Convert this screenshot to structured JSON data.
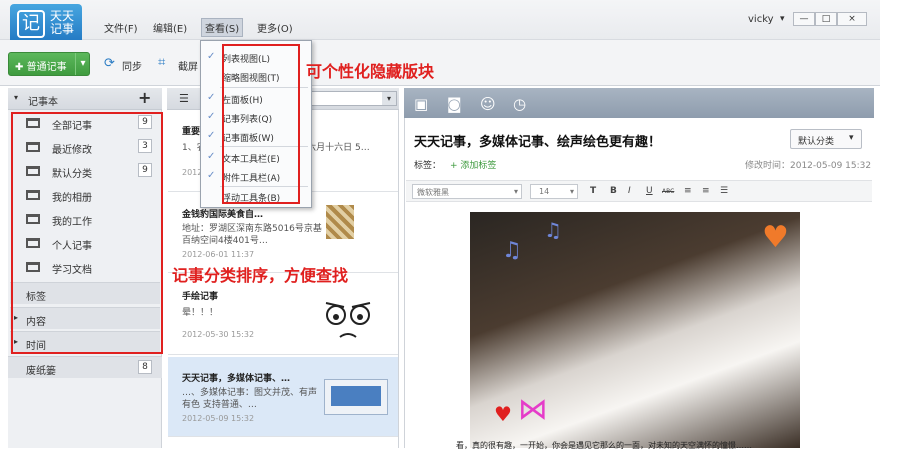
{
  "app": {
    "logo_char": "记",
    "logo_text": "天天记事"
  },
  "menu": {
    "file": "文件(F)",
    "edit": "编辑(E)",
    "view": "查看(S)",
    "more": "更多(O)"
  },
  "window": {
    "user": "vicky",
    "user_caret": "▾",
    "minimize": "—",
    "maximize": "□",
    "close": "×"
  },
  "toolbar": {
    "new_note": "普通记事",
    "new_note_icon": "✚",
    "new_note_arrow": "▾",
    "sync": "同步",
    "screenshot": "截屏",
    "sync_icon": "⟳",
    "screenshot_icon": "⌗"
  },
  "view_menu": {
    "items": [
      "列表视图(L)",
      "缩略图视图(T)",
      "左面板(H)",
      "记事列表(Q)",
      "记事面板(W)",
      "文本工具栏(E)",
      "附件工具栏(A)",
      "浮动工具条(B)"
    ],
    "checked": [
      true,
      false,
      true,
      true,
      true,
      true,
      true,
      false
    ],
    "check_char": "✓"
  },
  "sidebar": {
    "header": "记事本",
    "header_arrow": "▾",
    "add": "+",
    "items": [
      {
        "label": "全部记事",
        "count": "9"
      },
      {
        "label": "最近修改",
        "count": "3"
      },
      {
        "label": "默认分类",
        "count": "9"
      },
      {
        "label": "我的相册",
        "count": ""
      },
      {
        "label": "我的工作",
        "count": ""
      },
      {
        "label": "个人记事",
        "count": ""
      },
      {
        "label": "学习文档",
        "count": ""
      }
    ],
    "tags": "标签",
    "content": "内容",
    "time": "时间",
    "tri": "▸",
    "trash": "废纸篓",
    "trash_count": "8"
  },
  "notes": {
    "list_icon": "☰",
    "items": [
      {
        "title": "重要",
        "body": "1、农历五月十二、5… 妈妈 历六月十六日 5…",
        "date": "2012-05"
      },
      {
        "title": "金钱豹国际美食自…",
        "body": "地址：罗湖区深南东路5016号京基百纳空间4楼401号…",
        "date": "2012-06-01 11:37"
      },
      {
        "title": "手绘记事",
        "body": "晕！！！",
        "date": "2012-05-30 15:32"
      },
      {
        "title": "天天记事，多媒体记事、…",
        "body": "…、多媒体记事：图文并茂、有声有色 支持普通、…",
        "date": "2012-05-09 15:32"
      }
    ]
  },
  "editor": {
    "title": "天天记事，多媒体记事、绘声绘色更有趣！",
    "category": "默认分类",
    "category_arrow": "▾",
    "tags_label": "标签：",
    "add_tag": "+ 添加标签",
    "modified": "修改时间：2012-05-09 15:32",
    "font": "微软雅黑",
    "size": "14",
    "fmt": [
      "T",
      "B",
      "I",
      "U",
      "ABC",
      "≡",
      "≡",
      "☰"
    ],
    "icons": {
      "image": "▣",
      "camera": "◙",
      "smile": "☺",
      "clock": "◷"
    },
    "caption": "看，真的很有趣，一开始，你会是遇见它那么的一面，对未知的天空满怀的憧憬……"
  },
  "annotations": {
    "hide_blocks": "可个性化隐藏版块",
    "category_sort": "记事分类排序，方便查找"
  },
  "colors": {
    "accent": "#1f74c0",
    "annotation": "#e0201f",
    "green": "#3f9b3f"
  }
}
